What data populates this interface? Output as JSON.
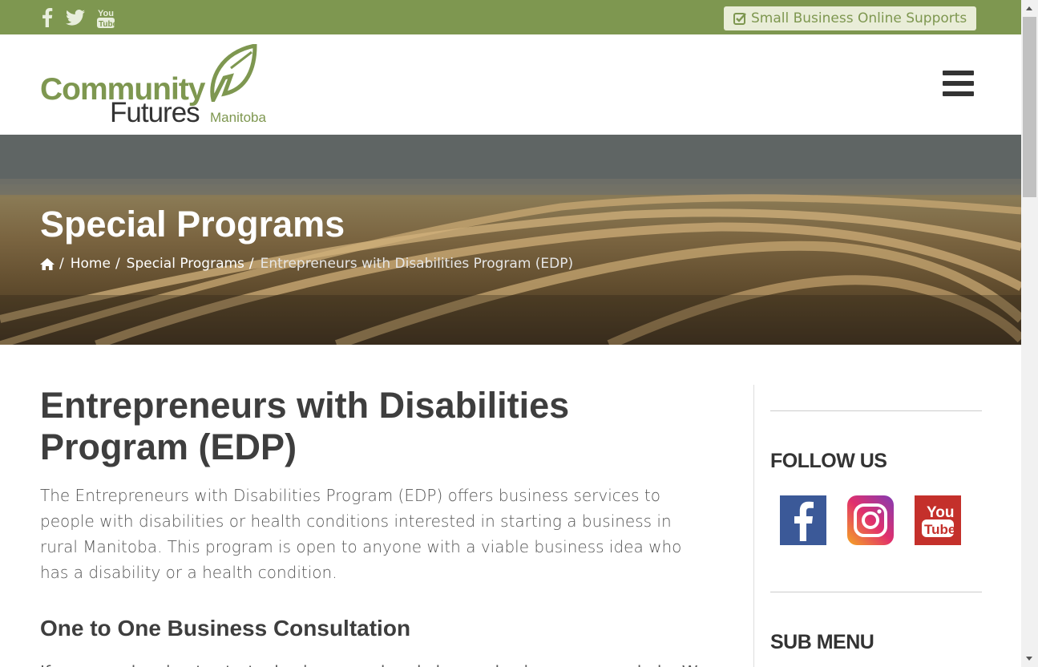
{
  "topbar": {
    "social": [
      "facebook-icon",
      "twitter-icon",
      "youtube-icon"
    ],
    "support_button": "Small Business Online Supports",
    "color": "#7e9750"
  },
  "header": {
    "logo": {
      "line1": "Community",
      "line2": "Futures",
      "line3": "Manitoba"
    },
    "menu_icon": "hamburger-icon"
  },
  "hero": {
    "title": "Special Programs",
    "breadcrumb": {
      "home_icon": "home-icon",
      "items": [
        "Home",
        "Special Programs"
      ],
      "current": "Entrepreneurs with Disabilities Program (EDP)"
    }
  },
  "main": {
    "heading": "Entrepreneurs with Disabilities Program (EDP)",
    "intro": "The Entrepreneurs with Disabilities Program (EDP) offers business services to people with disabilities or health conditions interested in starting a business in rural Manitoba.  This program is open to anyone with a viable business idea who has a disability or a health condition.",
    "subheading": "One to One Business Consultation",
    "next_paragraph": "If you are planning to start a business or already have a business, we can help. We can"
  },
  "sidebar": {
    "follow_title": "FOLLOW US",
    "follow_icons": [
      "facebook-icon",
      "instagram-icon",
      "youtube-icon"
    ],
    "submenu_title": "SUB MENU"
  }
}
